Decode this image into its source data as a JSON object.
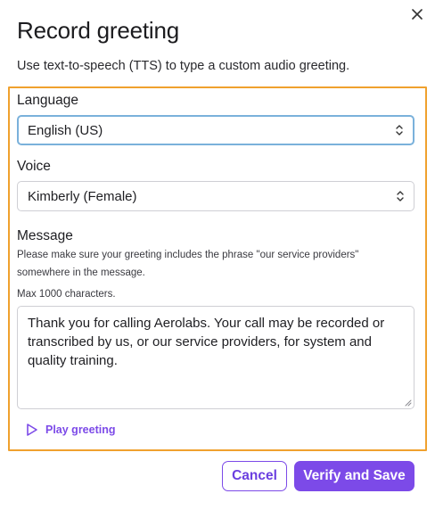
{
  "dialog": {
    "title": "Record greeting",
    "subtitle": "Use text-to-speech (TTS) to type a custom audio greeting.",
    "close_icon": "close-icon"
  },
  "language": {
    "label": "Language",
    "selected": "English (US)"
  },
  "voice": {
    "label": "Voice",
    "selected": "Kimberly (Female)"
  },
  "message": {
    "label": "Message",
    "helper_line1": "Please make sure your greeting includes the phrase \"our service providers\"",
    "helper_line2": "somewhere in the message.",
    "max_chars": "Max 1000 characters.",
    "value": "Thank you for calling Aerolabs. Your call may be recorded or transcribed by us, or our service providers, for system and quality training."
  },
  "play": {
    "label": "Play greeting",
    "icon": "play-icon"
  },
  "actions": {
    "cancel_label": "Cancel",
    "save_label": "Verify and Save"
  },
  "colors": {
    "accent": "#7c4ae8",
    "focus_outline": "#f0a12e",
    "select_focus": "#7ab1db"
  }
}
